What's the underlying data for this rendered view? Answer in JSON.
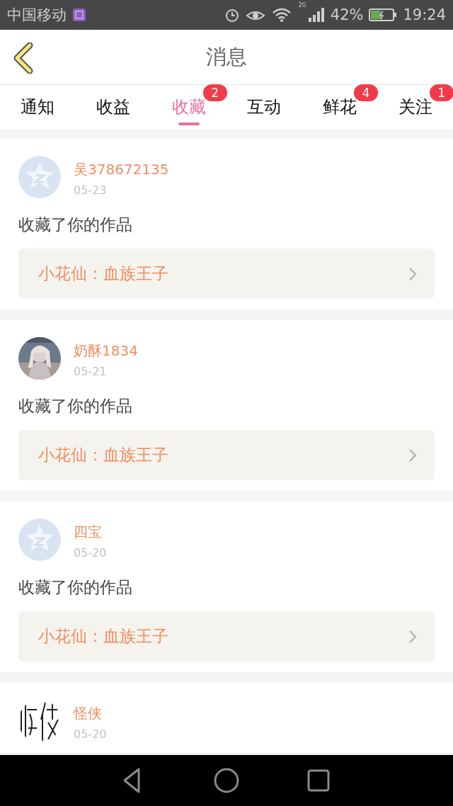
{
  "status_bar": {
    "carrier": "中国移动",
    "network": "2G",
    "battery": "42%",
    "time": "19:24"
  },
  "header": {
    "title": "消息"
  },
  "tabs": [
    {
      "label": "通知",
      "selected": false
    },
    {
      "label": "收益",
      "selected": false
    },
    {
      "label": "收藏",
      "selected": true,
      "badge": "2"
    },
    {
      "label": "互动",
      "selected": false
    },
    {
      "label": "鲜花",
      "selected": false,
      "badge": "4"
    },
    {
      "label": "关注",
      "selected": false,
      "badge": "1"
    }
  ],
  "messages": [
    {
      "avatar": {
        "kind": "default"
      },
      "name": "吴378672135",
      "date": "05-23",
      "text": "收藏了你的作品",
      "work": "小花仙：血族王子"
    },
    {
      "name": "奶酥1834",
      "date": "05-21",
      "text": "收藏了你的作品",
      "work": "小花仙：血族王子"
    },
    {
      "avatar": {
        "kind": "default"
      },
      "name": "四宝",
      "date": "05-20",
      "text": "收藏了你的作品",
      "work": "小花仙：血族王子"
    },
    {
      "avatar": {
        "kind": "ink"
      },
      "name": "怪侠",
      "date": "05-20"
    }
  ]
}
